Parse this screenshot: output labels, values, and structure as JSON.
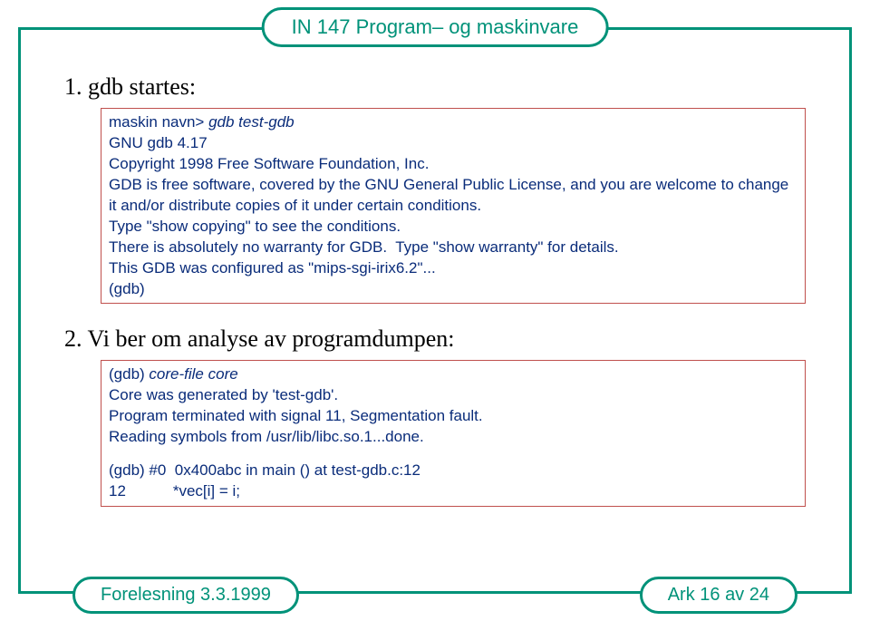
{
  "header": {
    "title": "IN 147 Program– og maskinvare"
  },
  "section1": {
    "heading": "1. gdb startes:",
    "lines": [
      {
        "parts": [
          {
            "t": "maskin navn> "
          },
          {
            "t": "gdb test-gdb",
            "i": true
          }
        ]
      },
      {
        "parts": [
          {
            "t": "GNU gdb 4.17"
          }
        ]
      },
      {
        "parts": [
          {
            "t": "Copyright 1998 Free Software Foundation, Inc."
          }
        ]
      },
      {
        "parts": [
          {
            "t": "GDB is free software, covered by the GNU General Public License, and you are welcome to change it and/or distribute copies of it under certain conditions."
          }
        ]
      },
      {
        "parts": [
          {
            "t": "Type \"show copying\" to see the conditions."
          }
        ]
      },
      {
        "parts": [
          {
            "t": "There is absolutely no warranty for GDB.  Type \"show warranty\" for details."
          }
        ]
      },
      {
        "parts": [
          {
            "t": "This GDB was configured as \"mips-sgi-irix6.2\"..."
          }
        ]
      },
      {
        "parts": [
          {
            "t": "(gdb)"
          }
        ]
      }
    ]
  },
  "section2": {
    "heading": "2. Vi ber om analyse av programdumpen:",
    "lines": [
      {
        "parts": [
          {
            "t": "(gdb) "
          },
          {
            "t": "core-file core",
            "i": true
          }
        ]
      },
      {
        "parts": [
          {
            "t": "Core was generated by 'test-gdb'."
          }
        ]
      },
      {
        "parts": [
          {
            "t": "Program terminated with signal 11, Segmentation fault."
          }
        ]
      },
      {
        "parts": [
          {
            "t": "Reading symbols from /usr/lib/libc.so.1...done."
          }
        ]
      },
      {
        "spacer": true
      },
      {
        "parts": [
          {
            "t": "(gdb) #0  0x400abc in main () at test-gdb.c:12"
          }
        ]
      },
      {
        "parts": [
          {
            "t": "12           *vec[i] = i;"
          }
        ]
      }
    ]
  },
  "footer": {
    "left": "Forelesning 3.3.1999",
    "right": "Ark 16 av 24"
  }
}
